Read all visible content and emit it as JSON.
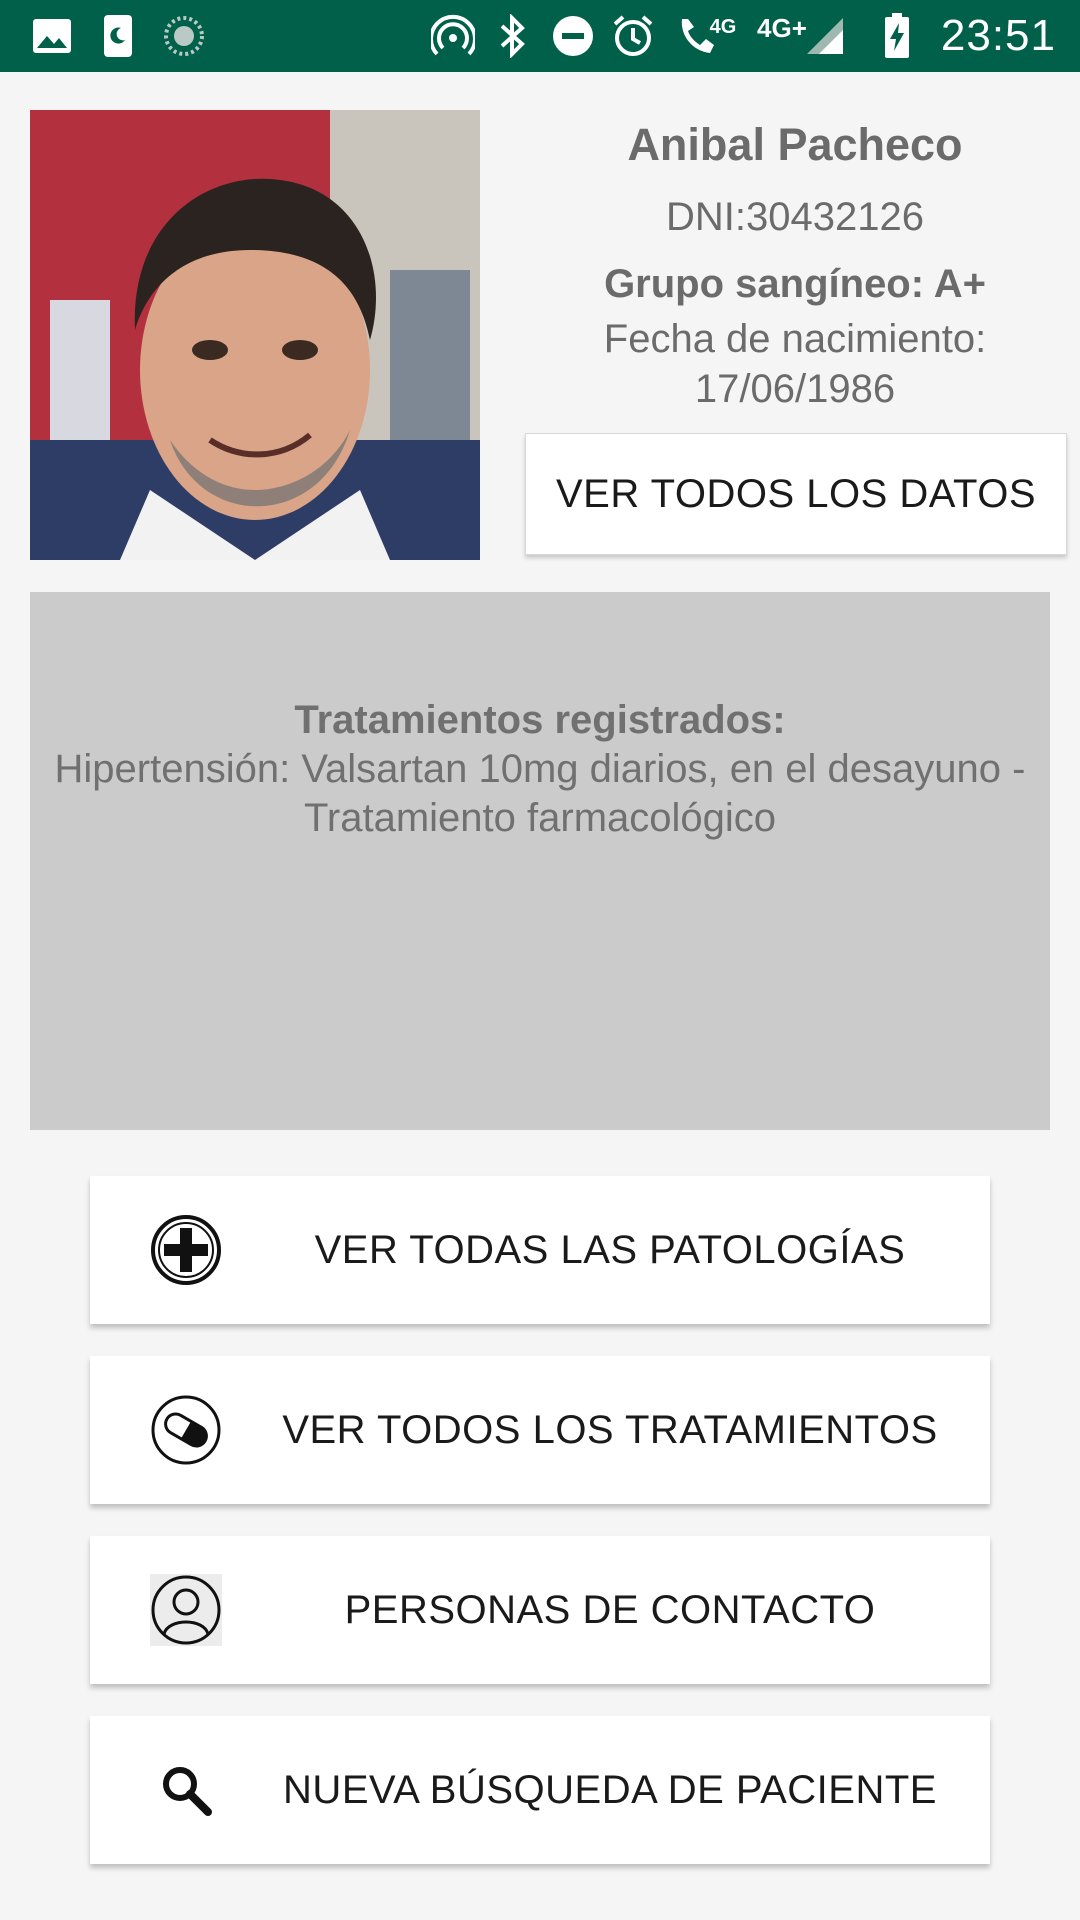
{
  "status_bar": {
    "time": "23:51",
    "network_4g": "4G",
    "network_4g_plus": "4G+",
    "icons": [
      "image-icon",
      "sim-icon",
      "sync-icon",
      "hotspot-icon",
      "bluetooth-icon",
      "do-not-disturb-icon",
      "alarm-icon",
      "wifi-call-icon",
      "signal-icon",
      "battery-charging-icon"
    ]
  },
  "patient": {
    "name": "Anibal Pacheco",
    "dni": "DNI:30432126",
    "blood_group": "Grupo sangíneo: A+",
    "birth_label": "Fecha de nacimiento:",
    "birth_date": "17/06/1986"
  },
  "buttons": {
    "ver_datos": "VER TODOS LOS DATOS",
    "patologias": "VER TODAS LAS PATOLOGÍAS",
    "tratamientos": "VER TODOS LOS TRATAMIENTOS",
    "contacto": "PERSONAS DE CONTACTO",
    "busqueda": "NUEVA BÚSQUEDA DE PACIENTE"
  },
  "treatments": {
    "title": "Tratamientos registrados:",
    "text": "Hipertensión: Valsartan 10mg diarios, en el desayuno - Tratamiento farmacológico"
  },
  "colors": {
    "status_bar": "#00604a",
    "panel_bg": "#cbcbcb",
    "text_gray": "#6b6b6b"
  }
}
